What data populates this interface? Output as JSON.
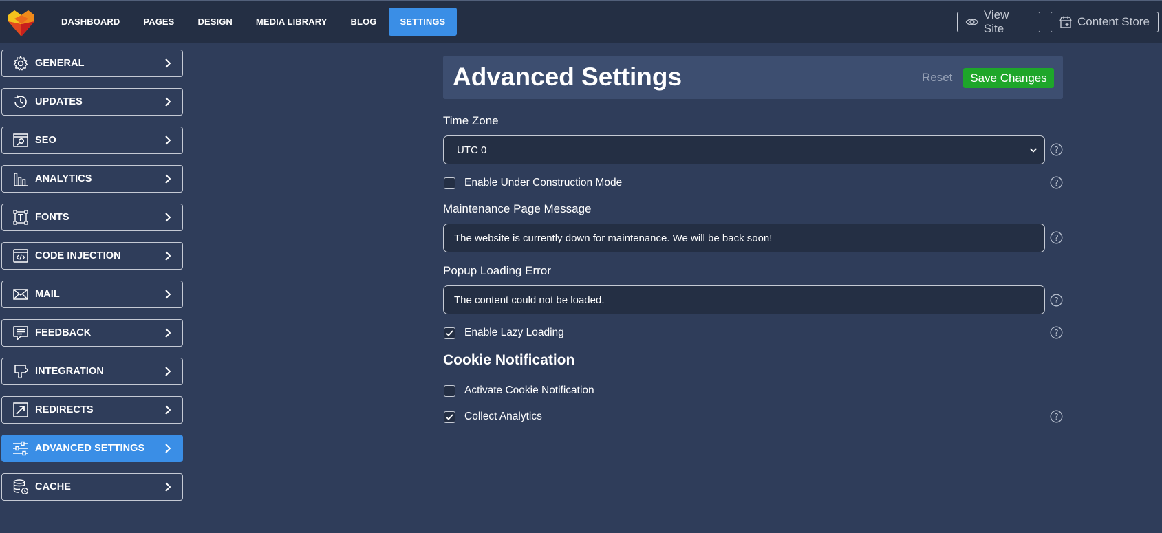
{
  "topnav": {
    "items": [
      {
        "label": "DASHBOARD"
      },
      {
        "label": "PAGES"
      },
      {
        "label": "DESIGN"
      },
      {
        "label": "MEDIA LIBRARY"
      },
      {
        "label": "BLOG"
      },
      {
        "label": "SETTINGS",
        "active": true
      }
    ],
    "view_site": "View Site",
    "content_store": "Content Store"
  },
  "sidebar": {
    "items": [
      {
        "label": "GENERAL",
        "icon": "gear-icon"
      },
      {
        "label": "UPDATES",
        "icon": "history-icon"
      },
      {
        "label": "SEO",
        "icon": "seo-search-icon"
      },
      {
        "label": "ANALYTICS",
        "icon": "bar-chart-icon"
      },
      {
        "label": "FONTS",
        "icon": "font-icon"
      },
      {
        "label": "CODE INJECTION",
        "icon": "code-icon"
      },
      {
        "label": "MAIL",
        "icon": "mail-icon"
      },
      {
        "label": "FEEDBACK",
        "icon": "feedback-icon"
      },
      {
        "label": "INTEGRATION",
        "icon": "puzzle-icon"
      },
      {
        "label": "REDIRECTS",
        "icon": "redirect-icon"
      },
      {
        "label": "ADVANCED SETTINGS",
        "icon": "sliders-icon",
        "active": true
      },
      {
        "label": "CACHE",
        "icon": "database-clock-icon"
      }
    ]
  },
  "header": {
    "title": "Advanced Settings",
    "reset": "Reset",
    "save": "Save Changes"
  },
  "form": {
    "timezone": {
      "label": "Time Zone",
      "value": "UTC 0"
    },
    "under_construction": {
      "label": "Enable Under Construction Mode",
      "checked": false
    },
    "maintenance": {
      "label": "Maintenance Page Message",
      "value": "The website is currently down for maintenance. We will be back soon!"
    },
    "popup_error": {
      "label": "Popup Loading Error",
      "value": "The content could not be loaded."
    },
    "lazy_loading": {
      "label": "Enable Lazy Loading",
      "checked": true
    },
    "cookie_section": "Cookie Notification",
    "activate_cookie": {
      "label": "Activate Cookie Notification",
      "checked": false
    },
    "collect_analytics": {
      "label": "Collect Analytics",
      "checked": true
    }
  },
  "colors": {
    "background": "#2f3d5a",
    "topbar": "#242f44",
    "accent": "#3a8ee6",
    "save": "#1ea62a"
  }
}
